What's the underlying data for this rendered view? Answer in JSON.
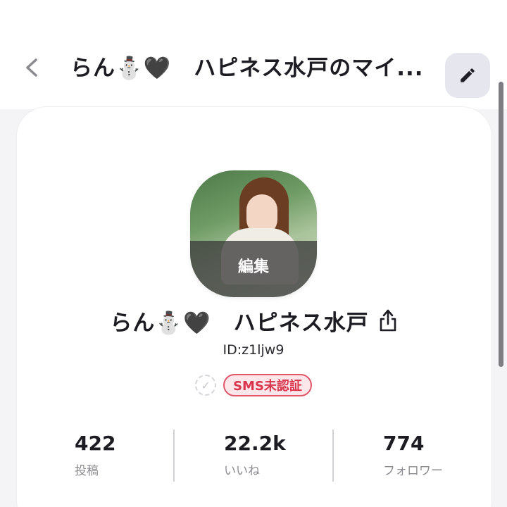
{
  "header": {
    "title": "らん⛄🖤　ハピネス水戸のマイ...",
    "back_icon": "chevron-left-icon",
    "edit_icon": "pencil-icon"
  },
  "profile": {
    "avatar_edit_label": "編集",
    "name": "らん⛄🖤　ハピネス水戸",
    "share_icon": "share-icon",
    "user_id": "ID:z1ljw9",
    "verify_icon": "check-circle-icon",
    "sms_status": "SMS未認証"
  },
  "stats": [
    {
      "value": "422",
      "label": "投稿"
    },
    {
      "value": "22.2k",
      "label": "いいね"
    },
    {
      "value": "774",
      "label": "フォロワー"
    }
  ],
  "colors": {
    "sms_badge_text": "#d9364d",
    "sms_badge_bg": "#fde7ea",
    "edit_button_bg": "#e6e6ee"
  }
}
